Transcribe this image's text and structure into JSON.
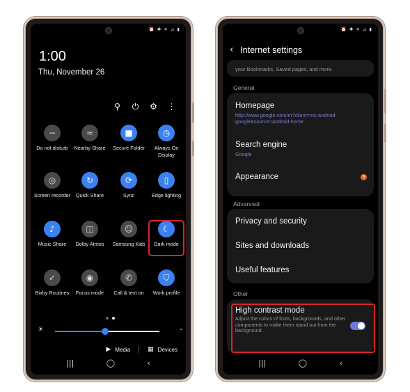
{
  "left_phone": {
    "time": "1:00",
    "date": "Thu, November 26",
    "top_actions": [
      {
        "icon": "search-icon",
        "glyph": "⚲"
      },
      {
        "icon": "power-icon",
        "glyph": "⏻"
      },
      {
        "icon": "gear-icon",
        "glyph": "⚙"
      },
      {
        "icon": "more-vertical-icon",
        "glyph": "⋮"
      }
    ],
    "tiles": [
      {
        "label": "Do not disturb",
        "icon": "minus-circle-icon",
        "glyph": "−",
        "state": "off"
      },
      {
        "label": "Nearby Share",
        "icon": "nearby-share-icon",
        "glyph": "≈",
        "state": "off"
      },
      {
        "label": "Secure Folder",
        "icon": "folder-icon",
        "glyph": "■",
        "state": "on"
      },
      {
        "label": "Always On Display",
        "icon": "clock-icon",
        "glyph": "◷",
        "state": "on"
      },
      {
        "label": "Screen recorder",
        "icon": "screen-recorder-icon",
        "glyph": "◎",
        "state": "off"
      },
      {
        "label": "Quick Share",
        "icon": "quick-share-icon",
        "glyph": "↻",
        "state": "on"
      },
      {
        "label": "Sync",
        "icon": "sync-icon",
        "glyph": "⟳",
        "state": "on"
      },
      {
        "label": "Edge lighting",
        "icon": "edge-lighting-icon",
        "glyph": "▯",
        "state": "on"
      },
      {
        "label": "Music Share",
        "icon": "music-icon",
        "glyph": "♪",
        "state": "on"
      },
      {
        "label": "Dolby Atmos",
        "icon": "dolby-icon",
        "glyph": "◫",
        "state": "off"
      },
      {
        "label": "Samsung Kids",
        "icon": "kids-icon",
        "glyph": "☺",
        "state": "off"
      },
      {
        "label": "Dark mode",
        "icon": "moon-icon",
        "glyph": "☾",
        "state": "on"
      },
      {
        "label": "Bixby Routines",
        "icon": "bixby-routines-icon",
        "glyph": "✓",
        "state": "off"
      },
      {
        "label": "Focus mode",
        "icon": "focus-mode-icon",
        "glyph": "◉",
        "state": "off"
      },
      {
        "label": "Call & text on",
        "icon": "call-text-icon",
        "glyph": "✆",
        "state": "off"
      },
      {
        "label": "Work profile",
        "icon": "work-profile-icon",
        "glyph": "⛉",
        "state": "on"
      }
    ],
    "page_indicator": {
      "current": 2,
      "total": 2
    },
    "brightness": {
      "level": 0.48
    },
    "media_label": "Media",
    "devices_label": "Devices"
  },
  "right_phone": {
    "header_title": "Internet settings",
    "top_card_text": "your Bookmarks, Saved pages, and more.",
    "sections": {
      "general": "General",
      "advanced": "Advanced",
      "other": "Other"
    },
    "homepage": {
      "title": "Homepage",
      "value": "http://www.google.com/m?client=ms-android-google&source=android-home"
    },
    "search_engine": {
      "title": "Search engine",
      "value": "Google"
    },
    "appearance": {
      "title": "Appearance",
      "badge": "N"
    },
    "privacy": "Privacy and security",
    "sites": "Sites and downloads",
    "useful": "Useful features",
    "high_contrast": {
      "title": "High contrast mode",
      "desc": "Adjust the colors of fonts, backgrounds, and other components to make them stand out from the background.",
      "enabled": true
    }
  },
  "navbar": {
    "recents": "|||",
    "home": "◯",
    "back": "‹"
  },
  "status_icons": "⏰ ✱ ✕ ⊿ ▮",
  "colors": {
    "accent_blue": "#3b82f0",
    "highlight_red": "#d8252d",
    "toggle_purple": "#6d79d8",
    "link_purple": "#7d7dcc"
  }
}
